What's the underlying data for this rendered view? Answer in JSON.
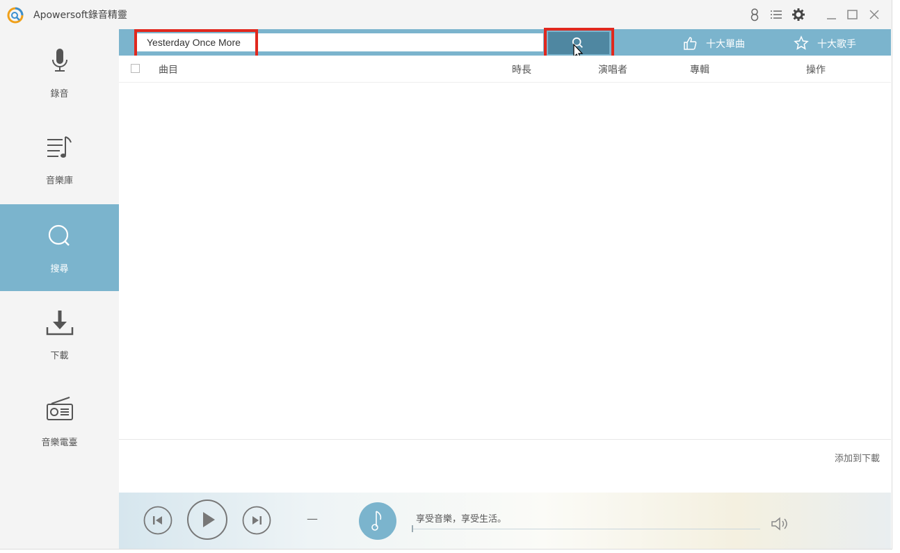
{
  "app": {
    "title": "Apowersoft錄音精靈"
  },
  "titlebar": {
    "icons": [
      "user-icon",
      "menu-list-icon",
      "gear-icon",
      "minimize-icon",
      "maximize-icon",
      "close-icon"
    ]
  },
  "sidebar": {
    "items": [
      {
        "label": "錄音",
        "icon": "microphone-icon",
        "active": false
      },
      {
        "label": "音樂庫",
        "icon": "music-library-icon",
        "active": false
      },
      {
        "label": "搜尋",
        "icon": "search-icon",
        "active": true
      },
      {
        "label": "下載",
        "icon": "download-icon",
        "active": false
      },
      {
        "label": "音樂電臺",
        "icon": "radio-icon",
        "active": false
      }
    ]
  },
  "search": {
    "value": "Yesterday Once More",
    "top_singles_label": "十大單曲",
    "top_singers_label": "十大歌手"
  },
  "table": {
    "columns": [
      "曲目",
      "時長",
      "演唱者",
      "專輯",
      "操作"
    ],
    "rows": []
  },
  "actions": {
    "add_to_download": "添加到下載"
  },
  "player": {
    "time_display": "—",
    "slogan": "享受音樂，享受生活。"
  },
  "colors": {
    "accent": "#7bb4cd",
    "search_button": "#4f87a1",
    "highlight": "#e0281e"
  }
}
